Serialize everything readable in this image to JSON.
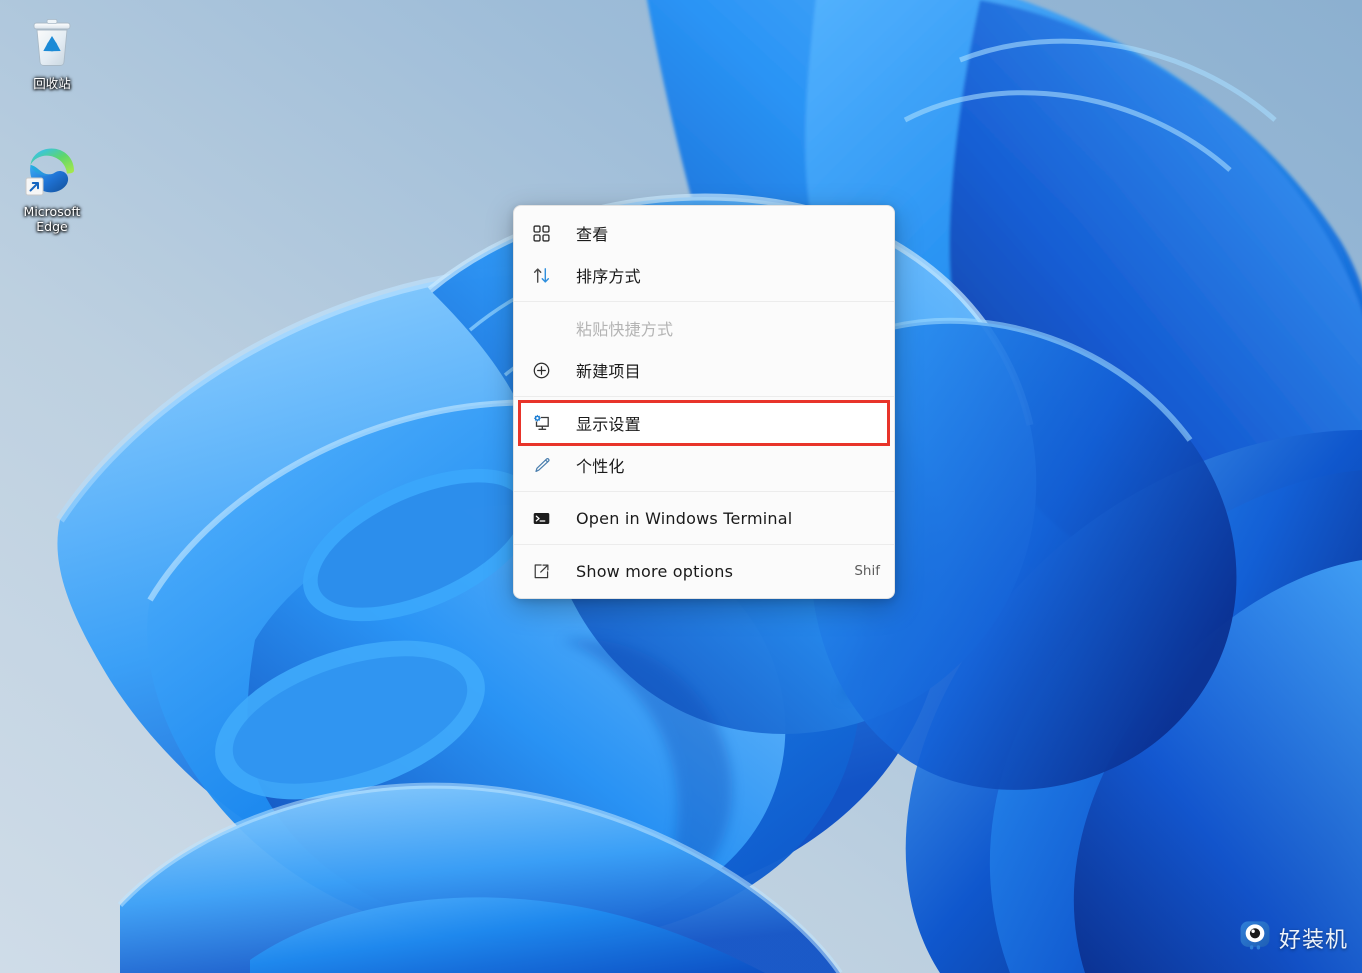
{
  "desktop": {
    "icons": [
      {
        "name": "recycle-bin",
        "label": "回收站",
        "icon": "recycle-bin-icon"
      },
      {
        "name": "microsoft-edge",
        "label": "Microsoft\nEdge",
        "label_line1": "Microsoft",
        "label_line2": "Edge",
        "icon": "edge-icon",
        "has_shortcut_badge": true
      }
    ]
  },
  "context_menu": {
    "items": [
      {
        "id": "view",
        "label": "查看",
        "icon": "grid-view-icon",
        "accel": "",
        "disabled": false,
        "highlighted": false
      },
      {
        "id": "sort-by",
        "label": "排序方式",
        "icon": "sort-arrows-icon",
        "accel": "",
        "disabled": false,
        "highlighted": false
      },
      {
        "id": "paste-shortcut",
        "label": "粘贴快捷方式",
        "icon": "",
        "accel": "",
        "disabled": true,
        "highlighted": false
      },
      {
        "id": "new-item",
        "label": "新建项目",
        "icon": "plus-circle-icon",
        "accel": "",
        "disabled": false,
        "highlighted": false
      },
      {
        "id": "display-settings",
        "label": "显示设置",
        "icon": "monitor-gear-icon",
        "accel": "",
        "disabled": false,
        "highlighted": true
      },
      {
        "id": "personalize",
        "label": "个性化",
        "icon": "pen-brush-icon",
        "accel": "",
        "disabled": false,
        "highlighted": false
      },
      {
        "id": "open-terminal",
        "label": "Open in Windows Terminal",
        "icon": "terminal-icon",
        "accel": "",
        "disabled": false,
        "highlighted": false
      },
      {
        "id": "show-more",
        "label": "Show more options",
        "icon": "expand-arrow-icon",
        "accel": "Shif",
        "disabled": false,
        "highlighted": false
      }
    ]
  },
  "watermark": {
    "text": "好装机",
    "icon": "eye-logo-icon"
  },
  "colors": {
    "accent_blue": "#0078d4",
    "highlight_red": "#e8342a",
    "menu_background": "#fbfbfb",
    "menu_text": "#1a1a1a",
    "disabled_text": "#b4b4b4",
    "wallpaper_light": "#c5d4e3",
    "wallpaper_mid": "#8fb5d4",
    "ribbon_bright": "#1f97f5",
    "ribbon_deep": "#0b2f9e"
  }
}
